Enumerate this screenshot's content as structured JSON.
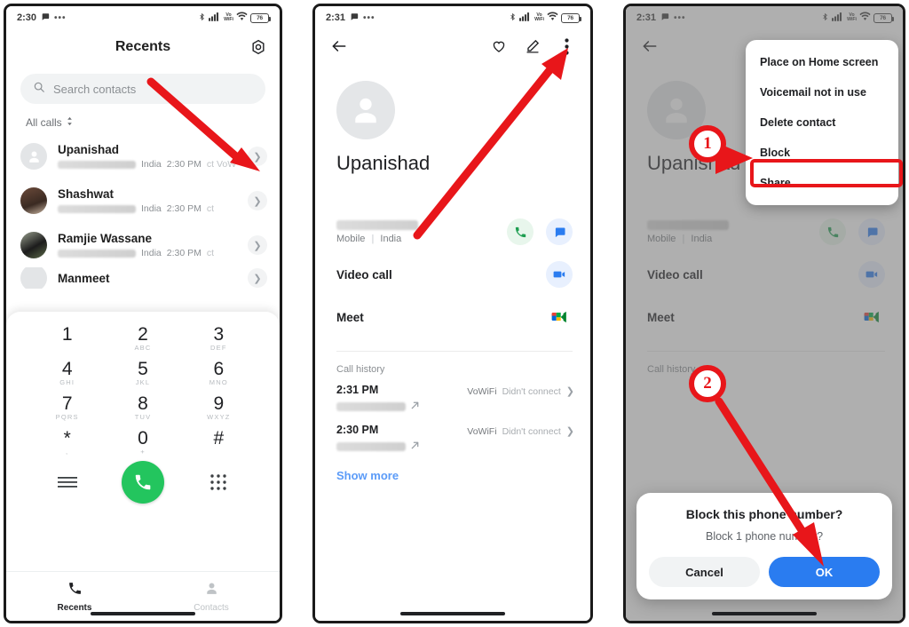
{
  "meta": {
    "accent_red": "#e8161a",
    "accent_blue": "#2a7cf0",
    "accent_green": "#23c55e",
    "link_blue": "#5b9bf8"
  },
  "panel1": {
    "statusbar": {
      "time": "2:30",
      "battery": "76"
    },
    "header": {
      "title": "Recents",
      "settings_icon": "gear-icon"
    },
    "search": {
      "placeholder": "Search contacts",
      "icon": "search-icon"
    },
    "filter": {
      "label": "All calls",
      "icon": "sort-chevrons-icon"
    },
    "calls": [
      {
        "name": "Upanishad",
        "country": "India",
        "time": "2:30 PM",
        "extra": "ct VoW"
      },
      {
        "name": "Shashwat",
        "country": "India",
        "time": "2:30 PM",
        "extra": "ct"
      },
      {
        "name": "Ramjie Wassane",
        "country": "India",
        "time": "2:30 PM",
        "extra": "ct"
      },
      {
        "name": "Manmeet",
        "country": "",
        "time": "",
        "extra": ""
      }
    ],
    "keypad": [
      {
        "num": "1",
        "sub": ""
      },
      {
        "num": "2",
        "sub": "ABC"
      },
      {
        "num": "3",
        "sub": "DEF"
      },
      {
        "num": "4",
        "sub": "GHI"
      },
      {
        "num": "5",
        "sub": "JKL"
      },
      {
        "num": "6",
        "sub": "MNO"
      },
      {
        "num": "7",
        "sub": "PQRS"
      },
      {
        "num": "8",
        "sub": "TUV"
      },
      {
        "num": "9",
        "sub": "WXYZ"
      },
      {
        "num": "*",
        "sub": ","
      },
      {
        "num": "0",
        "sub": "+"
      },
      {
        "num": "#",
        "sub": ""
      }
    ],
    "actions": {
      "menu_icon": "hamburger-icon",
      "call_icon": "phone-call-icon",
      "dialpad_icon": "dialpad-grid-icon"
    },
    "bottomnav": [
      {
        "label": "Recents",
        "icon": "phone-handset-icon",
        "active": true
      },
      {
        "label": "Contacts",
        "icon": "person-icon",
        "active": false
      }
    ]
  },
  "panel2": {
    "statusbar": {
      "time": "2:31",
      "battery": "76"
    },
    "header": {
      "back_icon": "back-arrow-icon",
      "favorite_icon": "heart-outline-icon",
      "edit_icon": "pencil-edit-icon",
      "overflow_icon": "more-vert-icon"
    },
    "contact": {
      "name": "Upanishad",
      "avatar_icon": "person-placeholder-icon"
    },
    "rows": [
      {
        "label": "",
        "sub_type": "Mobile",
        "sub_sep": "|",
        "sub_region": "India",
        "icons": [
          "phone-call-icon",
          "message-icon"
        ]
      },
      {
        "label": "Video call",
        "sub_type": "",
        "sub_sep": "",
        "sub_region": "",
        "icons": [
          "video-camera-icon"
        ]
      },
      {
        "label": "Meet",
        "sub_type": "",
        "sub_sep": "",
        "sub_region": "",
        "icons": [
          "google-meet-icon"
        ]
      }
    ],
    "history": {
      "title": "Call history",
      "entries": [
        {
          "time": "2:31 PM",
          "network": "VoWiFi",
          "status": "Didn't connect",
          "direction_icon": "outgoing-call-arrow-icon"
        },
        {
          "time": "2:30 PM",
          "network": "VoWiFi",
          "status": "Didn't connect",
          "direction_icon": "outgoing-call-arrow-icon"
        }
      ],
      "show_more": "Show more"
    }
  },
  "panel3": {
    "statusbar": {
      "time": "2:31",
      "battery": "76"
    },
    "header": {
      "back_icon": "back-arrow-icon"
    },
    "contact": {
      "name": "Upanishad",
      "avatar_icon": "person-placeholder-icon"
    },
    "menu": {
      "items": [
        "Place on Home screen",
        "Voicemail not in use",
        "Delete contact",
        "Block",
        "Share"
      ],
      "highlighted": "Block"
    },
    "rows": [
      {
        "label": "",
        "sub_type": "Mobile",
        "sub_sep": "|",
        "sub_region": "India",
        "icons": [
          "phone-call-icon",
          "message-icon"
        ]
      },
      {
        "label": "Video call",
        "sub_type": "",
        "sub_sep": "",
        "sub_region": "",
        "icons": [
          "video-camera-icon"
        ]
      },
      {
        "label": "Meet",
        "sub_type": "",
        "sub_sep": "",
        "sub_region": "",
        "icons": [
          "google-meet-icon"
        ]
      }
    ],
    "history": {
      "title": "Call history"
    },
    "dialog": {
      "title": "Block this phone number?",
      "message": "Block 1 phone number?",
      "cancel": "Cancel",
      "ok": "OK"
    }
  },
  "annotations": {
    "step1": "1",
    "step2": "2"
  }
}
